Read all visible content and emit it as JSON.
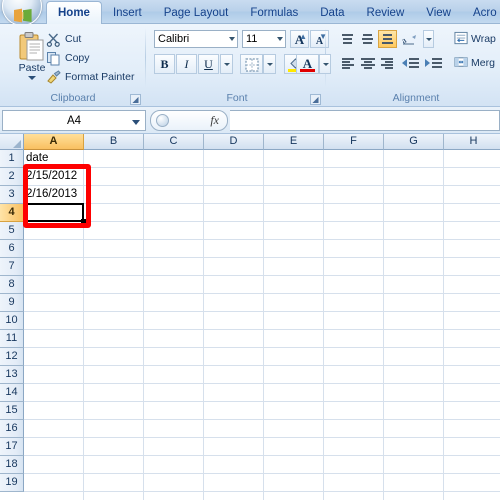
{
  "app": {
    "office_button": "office-orb"
  },
  "ribbon": {
    "tabs": [
      {
        "label": "Home",
        "active": true
      },
      {
        "label": "Insert",
        "active": false
      },
      {
        "label": "Page Layout",
        "active": false
      },
      {
        "label": "Formulas",
        "active": false
      },
      {
        "label": "Data",
        "active": false
      },
      {
        "label": "Review",
        "active": false
      },
      {
        "label": "View",
        "active": false
      },
      {
        "label": "Acro",
        "active": false
      }
    ],
    "groups": {
      "clipboard": {
        "label": "Clipboard",
        "paste": "Paste",
        "cut": "Cut",
        "copy": "Copy",
        "format_painter": "Format Painter"
      },
      "font": {
        "label": "Font",
        "font_name": "Calibri",
        "font_size": "11",
        "grow_font": "A",
        "shrink_font": "A",
        "bold": "B",
        "italic": "I",
        "underline": "U"
      },
      "alignment": {
        "label": "Alignment",
        "wrap_text": "Wrap",
        "merge_center": "Merg"
      }
    }
  },
  "formula_bar": {
    "name_box": "A4",
    "fx_label": "fx",
    "formula_value": ""
  },
  "grid": {
    "columns": [
      "A",
      "B",
      "C",
      "D",
      "E",
      "F",
      "G",
      "H"
    ],
    "active_column": "A",
    "rows": [
      "1",
      "2",
      "3",
      "4",
      "5",
      "6",
      "7",
      "8",
      "9",
      "10",
      "11",
      "12",
      "13",
      "14",
      "15",
      "16",
      "17",
      "18",
      "19"
    ],
    "active_row": "4",
    "cells": [
      {
        "col": 0,
        "row": 0,
        "value": "date"
      },
      {
        "col": 0,
        "row": 1,
        "value": "2/15/2012"
      },
      {
        "col": 0,
        "row": 2,
        "value": "2/16/2013"
      }
    ],
    "selected_cell": {
      "col": 0,
      "row": 3,
      "ref": "A4"
    },
    "annotation": {
      "color": "#fe0000",
      "covers": "A2:A4"
    }
  }
}
